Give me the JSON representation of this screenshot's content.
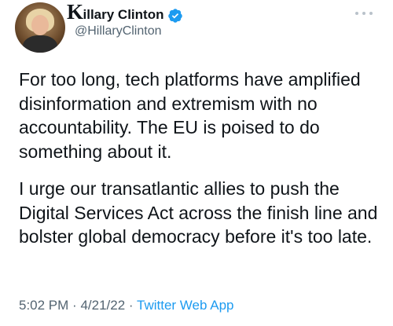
{
  "author": {
    "name_first_letter": "K",
    "name_rest": "illary Clinton",
    "handle": "@HillaryClinton",
    "verified": true,
    "verified_color": "#1d9bf0"
  },
  "tweet": {
    "paragraphs": [
      "For too long, tech platforms have amplified disinformation and extremism with no accountability. The EU is poised to do something about it.",
      "I urge our transatlantic allies to push the Digital Services Act across the finish line and bolster global democracy before it's too late."
    ],
    "time": "5:02 PM",
    "separator": "·",
    "date": "4/21/22",
    "source": "Twitter Web App"
  },
  "icons": {
    "more": "more-options-icon",
    "verified": "verified-badge-icon"
  },
  "colors": {
    "link": "#1d9bf0",
    "secondary_text": "#536471",
    "primary_text": "#0f1419"
  }
}
